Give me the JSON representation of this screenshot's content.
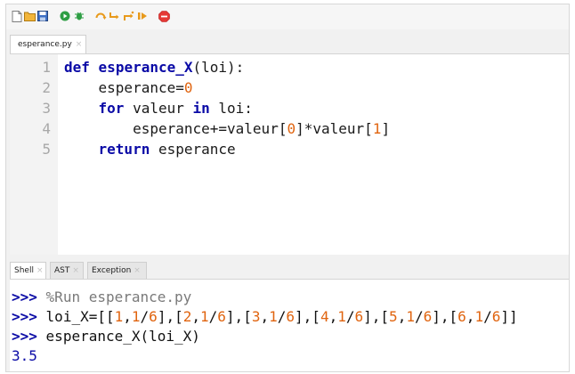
{
  "toolbar": {
    "icons": [
      "new-file-icon",
      "open-folder-icon",
      "save-icon",
      "run-icon",
      "debug-icon",
      "step-over-icon",
      "step-into-icon",
      "step-out-icon",
      "resume-icon",
      "stop-icon"
    ]
  },
  "editor": {
    "tab": {
      "label": "esperance.py",
      "close": "×"
    },
    "line_numbers": [
      "1",
      "2",
      "3",
      "4",
      "5"
    ],
    "code": {
      "l1_kw": "def",
      "l1_fn": "esperance_X",
      "l1_rest": "(loi):",
      "l2_a": "esperance=",
      "l2_num": "0",
      "l3_kw": "for",
      "l3_mid": " valeur ",
      "l3_kw2": "in",
      "l3_rest": " loi:",
      "l4_a": "esperance+=valeur[",
      "l4_n1": "0",
      "l4_b": "]*valeur[",
      "l4_n2": "1",
      "l4_c": "]",
      "l5_kw": "return",
      "l5_rest": " esperance"
    }
  },
  "shell": {
    "tabs": [
      {
        "label": "Shell",
        "close": "×"
      },
      {
        "label": "AST",
        "close": "×"
      },
      {
        "label": "Exception",
        "close": "×"
      }
    ],
    "prompt": ">>>",
    "line1": "%Run esperance.py",
    "line2": {
      "pre": "loi_X=[[",
      "parts": [
        "1",
        ",",
        "1",
        "/",
        "6",
        "],[",
        "2",
        ",",
        "1",
        "/",
        "6",
        "],[",
        "3",
        ",",
        "1",
        "/",
        "6",
        "],[",
        "4",
        ",",
        "1",
        "/",
        "6",
        "],[",
        "5",
        ",",
        "1",
        "/",
        "6",
        "],[",
        "6",
        ",",
        "1",
        "/",
        "6",
        "]]"
      ]
    },
    "line3": "esperance_X(loi_X)",
    "output": "3.5"
  },
  "colors": {
    "keyword": "#0a0aa6",
    "number": "#e0640f",
    "gutter": "#f3f3f3",
    "stop": "#e53935",
    "run": "#2e9e44"
  }
}
